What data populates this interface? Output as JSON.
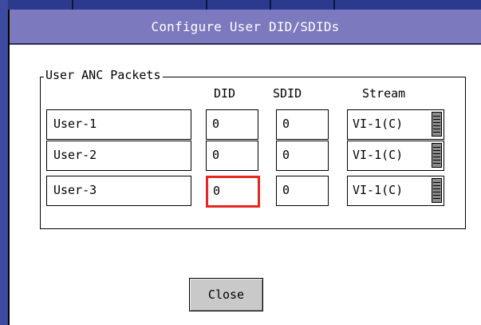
{
  "dialog": {
    "title": "Configure User DID/SDIDs",
    "group_label": "User ANC Packets",
    "columns": {
      "did": "DID",
      "sdid": "SDID",
      "stream": "Stream"
    },
    "rows": [
      {
        "name": "User-1",
        "did": "0",
        "sdid": "0",
        "stream": "VI-1(C)"
      },
      {
        "name": "User-2",
        "did": "0",
        "sdid": "0",
        "stream": "VI-1(C)"
      },
      {
        "name": "User-3",
        "did": "0",
        "sdid": "0",
        "stream": "VI-1(C)"
      }
    ],
    "focused_field": "User-3 DID",
    "close_label": "Close"
  },
  "colors": {
    "title_bar": "#7d79be",
    "focus_border": "#e8261f",
    "button_face": "#c9c9c9",
    "background_blue": "#2b3a8c"
  },
  "icons": {
    "stream_dropdown": "dropdown-grip-icon"
  }
}
